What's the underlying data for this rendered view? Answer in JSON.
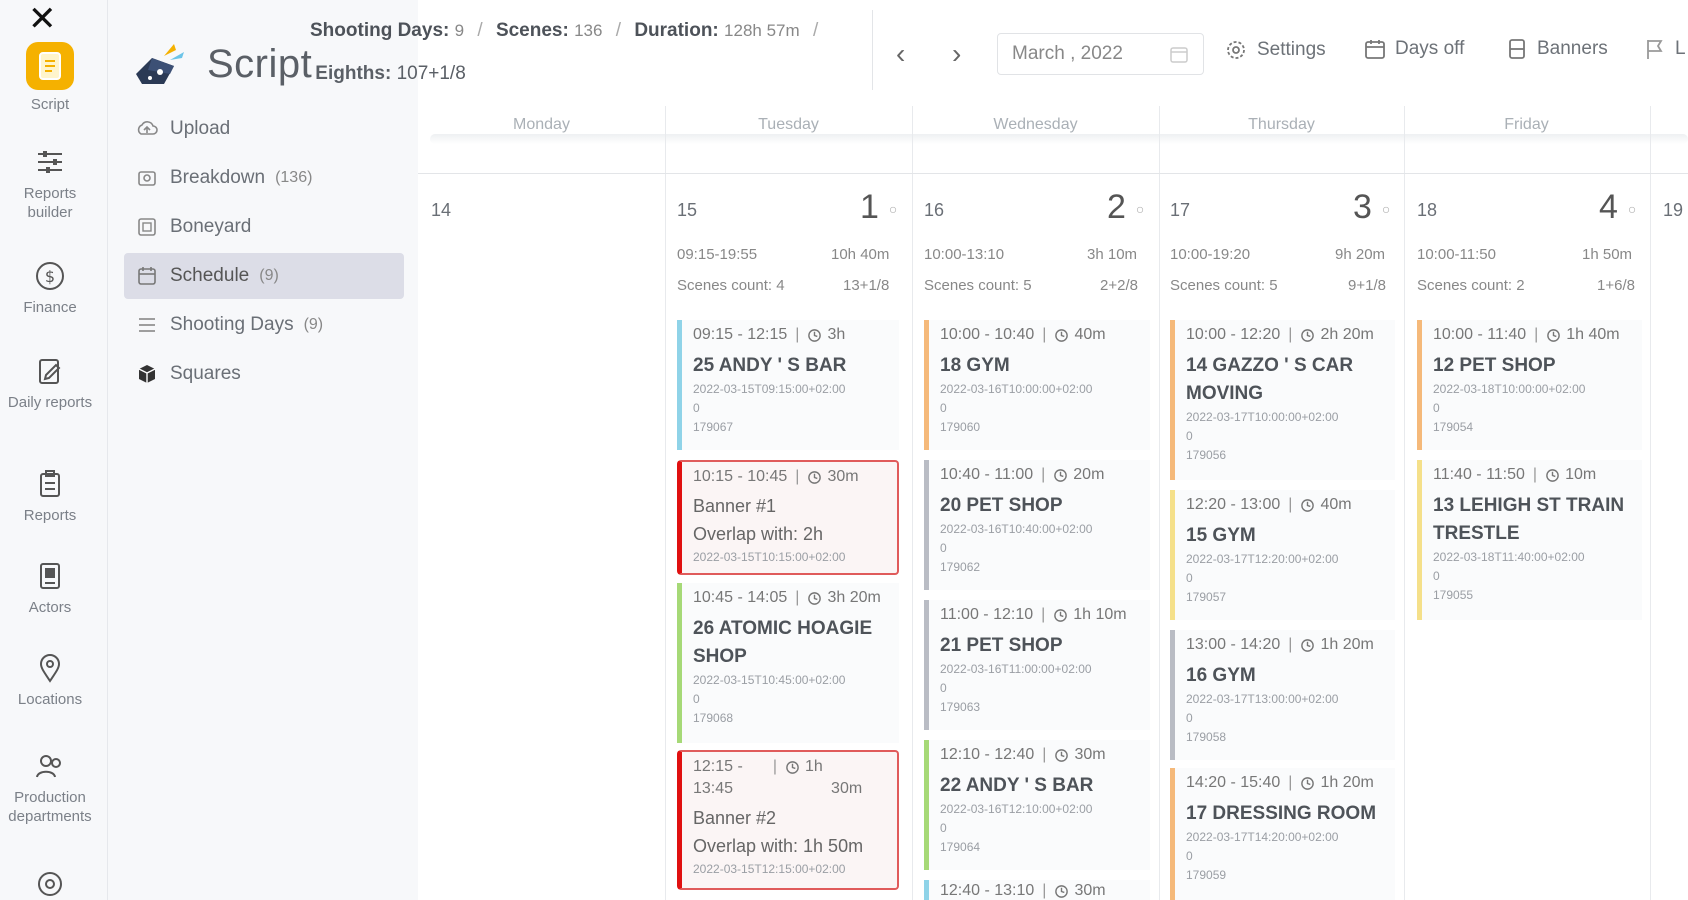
{
  "rail": [
    {
      "label": "Script",
      "icon": "script-icon",
      "active": true
    },
    {
      "label": "Reports builder",
      "icon": "sliders-icon"
    },
    {
      "label": "Finance",
      "icon": "dollar-icon"
    },
    {
      "label": "Daily reports",
      "icon": "daily-report-icon"
    },
    {
      "label": "Reports",
      "icon": "clipboard-icon"
    },
    {
      "label": "Actors",
      "icon": "actors-icon"
    },
    {
      "label": "Locations",
      "icon": "location-pin-icon"
    },
    {
      "label": "Production departments",
      "icon": "departments-icon"
    }
  ],
  "brand": "Script",
  "nav": [
    {
      "label": "Upload",
      "count": "",
      "icon": "upload-icon"
    },
    {
      "label": "Breakdown",
      "count": "(136)",
      "icon": "breakdown-icon"
    },
    {
      "label": "Boneyard",
      "count": "",
      "icon": "boneyard-icon"
    },
    {
      "label": "Schedule",
      "count": "(9)",
      "icon": "calendar-icon",
      "active": true
    },
    {
      "label": "Shooting Days",
      "count": "(9)",
      "icon": "list-icon"
    },
    {
      "label": "Squares",
      "count": "",
      "icon": "cube-icon"
    }
  ],
  "stats": {
    "days_label": "Shooting Days:",
    "days": "9",
    "scenes_label": "Scenes:",
    "scenes": "136",
    "duration_label": "Duration:",
    "duration": "128h 57m",
    "eighths_label": "Eighths:",
    "eighths": "107+1/8"
  },
  "toolbar": {
    "date": "March , 2022",
    "settings": "Settings",
    "days_off": "Days off",
    "banners": "Banners",
    "cut": "L"
  },
  "weekdays": [
    "Monday",
    "Tuesday",
    "Wednesday",
    "Thursday",
    "Friday"
  ],
  "days": [
    {
      "num": "14"
    },
    {
      "num": "15",
      "shoot": "1",
      "range": "09:15-19:55",
      "dur": "10h 40m",
      "scenes": "Scenes count: 4",
      "eighths": "13+1/8"
    },
    {
      "num": "16",
      "shoot": "2",
      "range": "10:00-13:10",
      "dur": "3h 10m",
      "scenes": "Scenes count: 5",
      "eighths": "2+2/8"
    },
    {
      "num": "17",
      "shoot": "3",
      "range": "10:00-19:20",
      "dur": "9h 20m",
      "scenes": "Scenes count: 5",
      "eighths": "9+1/8"
    },
    {
      "num": "18",
      "shoot": "4",
      "range": "10:00-11:50",
      "dur": "1h 50m",
      "scenes": "Scenes count: 2",
      "eighths": "1+6/8"
    },
    {
      "num": "19"
    }
  ],
  "cards": {
    "tue": [
      {
        "time": "09:15 - 12:15",
        "dur": "3h",
        "title": "25 ANDY ' S BAR",
        "ts": "2022-03-15T09:15:00+02:00",
        "zero": "0",
        "id": "179067",
        "color": "#8fd3e8"
      },
      {
        "time": "10:15 - 10:45",
        "dur": "30m",
        "title": "Banner #1",
        "overlap": "Overlap with: 2h",
        "ts": "2022-03-15T10:15:00+02:00",
        "banner": true
      },
      {
        "time": "10:45 - 14:05",
        "dur": "3h 20m",
        "title": "26 ATOMIC HOAGIE SHOP",
        "ts": "2022-03-15T10:45:00+02:00",
        "zero": "0",
        "id": "179068",
        "color": "#a6d977"
      },
      {
        "time": "12:15 -",
        "time2": "13:45",
        "dur": "1h",
        "dur2": "30m",
        "title": "Banner #2",
        "overlap": "Overlap with: 1h 50m",
        "ts": "2022-03-15T12:15:00+02:00",
        "banner": true
      }
    ],
    "wed": [
      {
        "time": "10:00 - 10:40",
        "dur": "40m",
        "title": "18 GYM",
        "ts": "2022-03-16T10:00:00+02:00",
        "zero": "0",
        "id": "179060",
        "color": "#f5b97a"
      },
      {
        "time": "10:40 - 11:00",
        "dur": "20m",
        "title": "20 PET SHOP",
        "ts": "2022-03-16T10:40:00+02:00",
        "zero": "0",
        "id": "179062",
        "color": "#b9bcc4"
      },
      {
        "time": "11:00 - 12:10",
        "dur": "1h 10m",
        "title": "21 PET SHOP",
        "ts": "2022-03-16T11:00:00+02:00",
        "zero": "0",
        "id": "179063",
        "color": "#b9bcc4"
      },
      {
        "time": "12:10 - 12:40",
        "dur": "30m",
        "title": "22 ANDY ' S BAR",
        "ts": "2022-03-16T12:10:00+02:00",
        "zero": "0",
        "id": "179064",
        "color": "#a6d977"
      },
      {
        "time": "12:40 - 13:10",
        "dur": "30m",
        "title": "",
        "ts": "",
        "zero": "",
        "id": "",
        "color": "#8fd3e8"
      }
    ],
    "thu": [
      {
        "time": "10:00 - 12:20",
        "dur": "2h 20m",
        "title": "14 GAZZO ' S CAR MOVING",
        "ts": "2022-03-17T10:00:00+02:00",
        "zero": "0",
        "id": "179056",
        "color": "#f5b97a"
      },
      {
        "time": "12:20 - 13:00",
        "dur": "40m",
        "title": "15 GYM",
        "ts": "2022-03-17T12:20:00+02:00",
        "zero": "0",
        "id": "179057",
        "color": "#f5e08a"
      },
      {
        "time": "13:00 - 14:20",
        "dur": "1h 20m",
        "title": "16 GYM",
        "ts": "2022-03-17T13:00:00+02:00",
        "zero": "0",
        "id": "179058",
        "color": "#b9bcc4"
      },
      {
        "time": "14:20 - 15:40",
        "dur": "1h 20m",
        "title": "17 DRESSING ROOM",
        "ts": "2022-03-17T14:20:00+02:00",
        "zero": "0",
        "id": "179059",
        "color": "#f5b97a"
      }
    ],
    "fri": [
      {
        "time": "10:00 - 11:40",
        "dur": "1h 40m",
        "title": "12 PET SHOP",
        "ts": "2022-03-18T10:00:00+02:00",
        "zero": "0",
        "id": "179054",
        "color": "#f5b97a"
      },
      {
        "time": "11:40 - 11:50",
        "dur": "10m",
        "title": "13 LEHIGH ST TRAIN TRESTLE",
        "ts": "2022-03-18T11:40:00+02:00",
        "zero": "0",
        "id": "179055",
        "color": "#f5e08a"
      }
    ]
  }
}
